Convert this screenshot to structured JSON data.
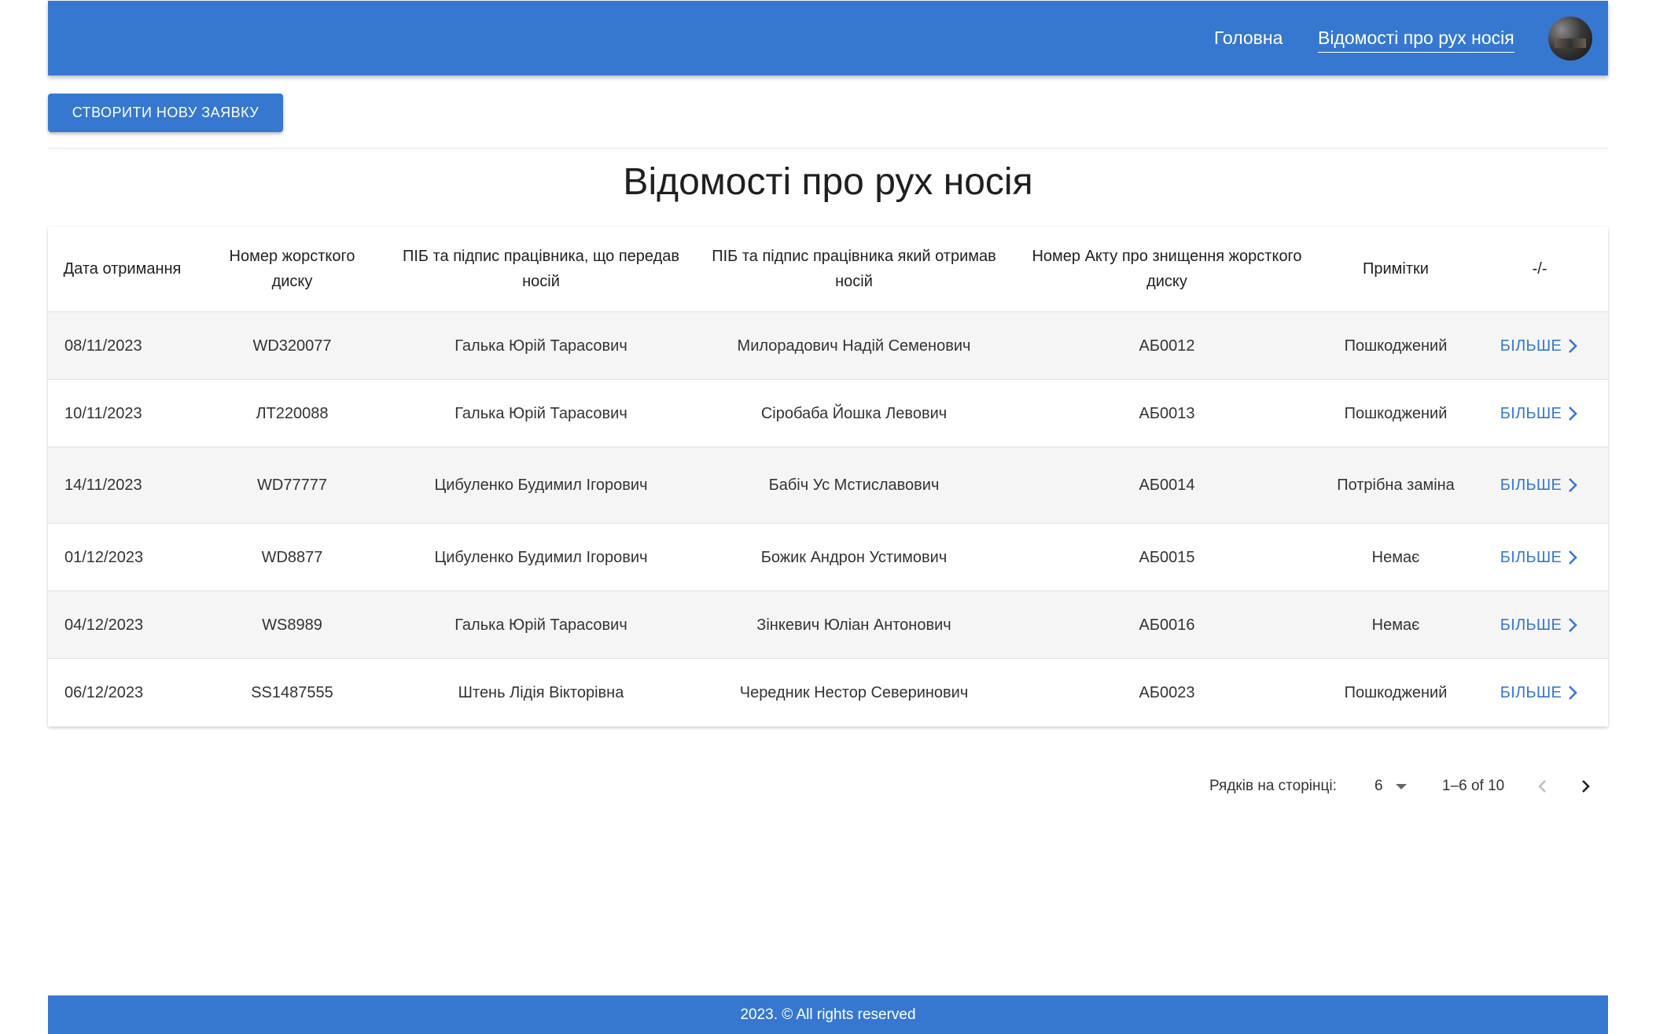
{
  "header": {
    "nav": [
      {
        "label": "Головна"
      },
      {
        "label": "Відомості про рух носія"
      }
    ]
  },
  "toolbar": {
    "create_label": "СТВОРИТИ НОВУ ЗАЯВКУ"
  },
  "main": {
    "title": "Відомості про рух носія"
  },
  "table": {
    "columns": [
      "Дата отримання",
      "Номер жорсткого диску",
      "ПІБ та підпис працівника, що передав носій",
      "ПІБ та підпис працівника який отримав носій",
      "Номер Акту про знищення жорсткого диску",
      "Примітки",
      "-/-"
    ],
    "rows": [
      {
        "date": "08/11/2023",
        "disk": "WD320077",
        "sender": "Галька Юрій Тарасович",
        "receiver": "Милорадович Надій Семенович",
        "act": "АБ0012",
        "note": "Пошкоджений",
        "action": "БІЛЬШЕ"
      },
      {
        "date": "10/11/2023",
        "disk": "ЛТ220088",
        "sender": "Галька Юрій Тарасович",
        "receiver": "Сіробаба Йошка Левович",
        "act": "АБ0013",
        "note": "Пошкоджений",
        "action": "БІЛЬШЕ"
      },
      {
        "date": "14/11/2023",
        "disk": "WD77777",
        "sender": "Цибуленко Будимил Ігорович",
        "receiver": "Бабіч Ус Мстиславович",
        "act": "АБ0014",
        "note": "Потрібна заміна",
        "action": "БІЛЬШЕ"
      },
      {
        "date": "01/12/2023",
        "disk": "WD8877",
        "sender": "Цибуленко Будимил Ігорович",
        "receiver": "Божик Андрон Устимович",
        "act": "АБ0015",
        "note": "Немає",
        "action": "БІЛЬШЕ"
      },
      {
        "date": "04/12/2023",
        "disk": "WS8989",
        "sender": "Галька Юрій Тарасович",
        "receiver": "Зінкевич Юліан Антонович",
        "act": "АБ0016",
        "note": "Немає",
        "action": "БІЛЬШЕ"
      },
      {
        "date": "06/12/2023",
        "disk": "SS1487555",
        "sender": "Штень Лідія Вікторівна",
        "receiver": "Чередник Нестор Северинович",
        "act": "АБ0023",
        "note": "Пошкоджений",
        "action": "БІЛЬШЕ"
      }
    ]
  },
  "pagination": {
    "rows_label": "Рядків на сторінці:",
    "rows_value": "6",
    "range": "1–6 of 10"
  },
  "footer": {
    "text": "2023. © All rights reserved"
  },
  "colors": {
    "primary": "#3678d0",
    "row_alt": "#f5f5f5"
  },
  "icons": {
    "more": "chevron-right-icon",
    "prev": "chevron-left-icon",
    "next": "chevron-right-icon",
    "select": "caret-down-icon"
  }
}
